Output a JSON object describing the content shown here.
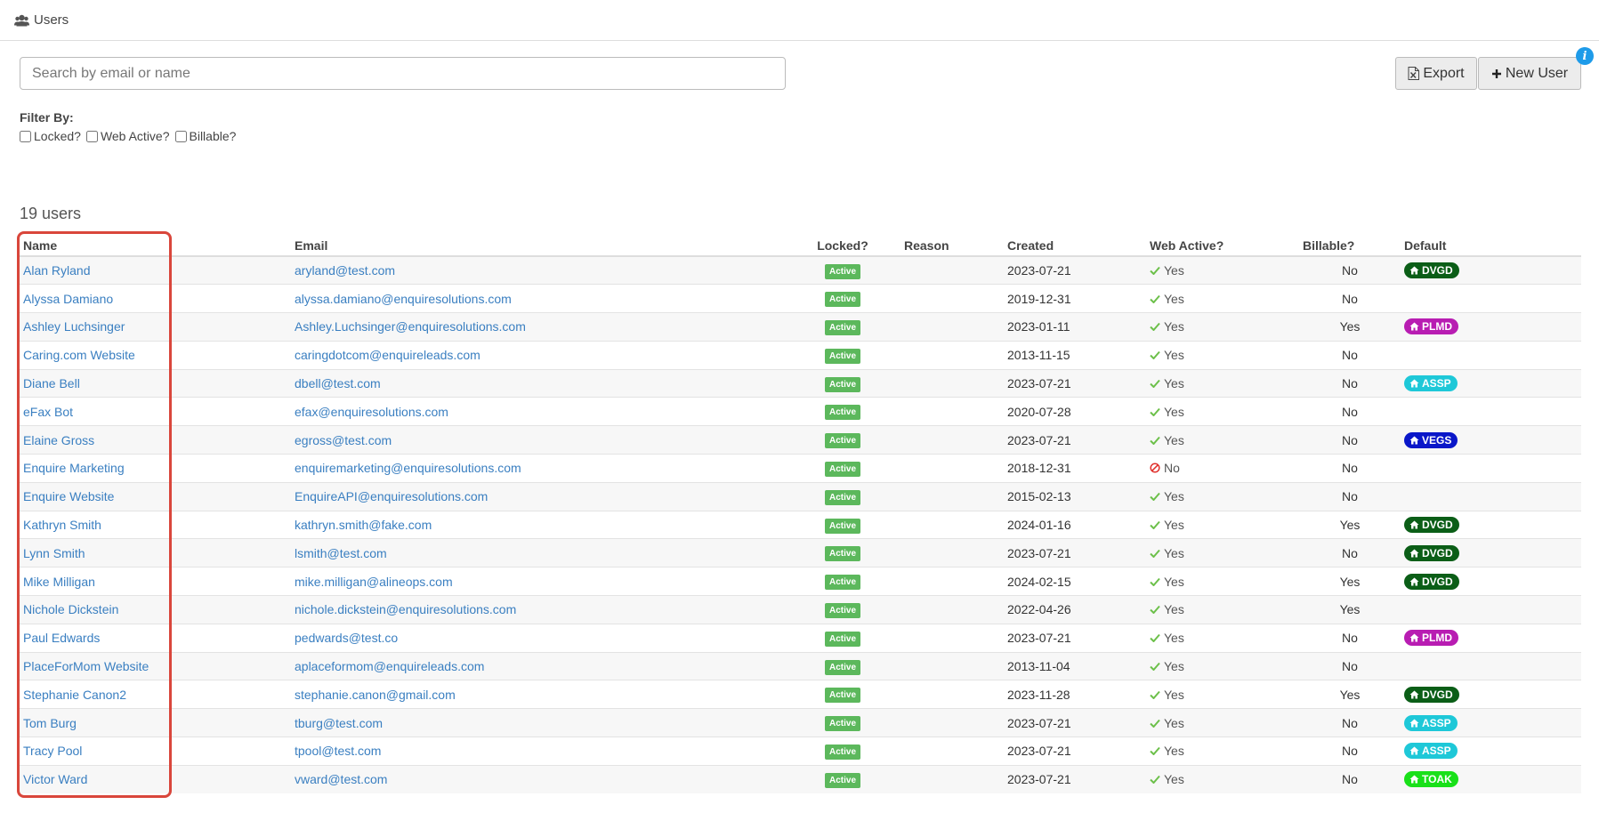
{
  "header": {
    "title": "Users",
    "icon": "users-icon"
  },
  "search": {
    "placeholder": "Search by email or name",
    "value": ""
  },
  "toolbar": {
    "export_label": "Export",
    "new_user_label": "New User",
    "info_label": "i"
  },
  "filters": {
    "title": "Filter By:",
    "options": [
      {
        "label": "Locked?",
        "checked": false
      },
      {
        "label": "Web Active?",
        "checked": false
      },
      {
        "label": "Billable?",
        "checked": false
      }
    ]
  },
  "summary": {
    "count_label": "19 users"
  },
  "table": {
    "columns": [
      "Name",
      "Email",
      "Locked?",
      "Reason",
      "Created",
      "Web Active?",
      "Billable?",
      "Default"
    ],
    "rows": [
      {
        "name": "Alan Ryland",
        "email": "aryland@test.com",
        "locked": "Active",
        "reason": "",
        "created": "2023-07-21",
        "web_active": "Yes",
        "billable": "No",
        "default": "DVGD",
        "default_color": "#0b5e17"
      },
      {
        "name": "Alyssa Damiano",
        "email": "alyssa.damiano@enquiresolutions.com",
        "locked": "Active",
        "reason": "",
        "created": "2019-12-31",
        "web_active": "Yes",
        "billable": "No",
        "default": "",
        "default_color": ""
      },
      {
        "name": "Ashley Luchsinger",
        "email": "Ashley.Luchsinger@enquiresolutions.com",
        "locked": "Active",
        "reason": "",
        "created": "2023-01-11",
        "web_active": "Yes",
        "billable": "Yes",
        "default": "PLMD",
        "default_color": "#b81db2"
      },
      {
        "name": "Caring.com Website",
        "email": "caringdotcom@enquireleads.com",
        "locked": "Active",
        "reason": "",
        "created": "2013-11-15",
        "web_active": "Yes",
        "billable": "No",
        "default": "",
        "default_color": ""
      },
      {
        "name": "Diane Bell",
        "email": "dbell@test.com",
        "locked": "Active",
        "reason": "",
        "created": "2023-07-21",
        "web_active": "Yes",
        "billable": "No",
        "default": "ASSP",
        "default_color": "#1ec8d8"
      },
      {
        "name": "eFax Bot",
        "email": "efax@enquiresolutions.com",
        "locked": "Active",
        "reason": "",
        "created": "2020-07-28",
        "web_active": "Yes",
        "billable": "No",
        "default": "",
        "default_color": ""
      },
      {
        "name": "Elaine Gross",
        "email": "egross@test.com",
        "locked": "Active",
        "reason": "",
        "created": "2023-07-21",
        "web_active": "Yes",
        "billable": "No",
        "default": "VEGS",
        "default_color": "#0a17c9"
      },
      {
        "name": "Enquire Marketing",
        "email": "enquiremarketing@enquiresolutions.com",
        "locked": "Active",
        "reason": "",
        "created": "2018-12-31",
        "web_active": "No",
        "billable": "No",
        "default": "",
        "default_color": ""
      },
      {
        "name": "Enquire Website",
        "email": "EnquireAPI@enquiresolutions.com",
        "locked": "Active",
        "reason": "",
        "created": "2015-02-13",
        "web_active": "Yes",
        "billable": "No",
        "default": "",
        "default_color": ""
      },
      {
        "name": "Kathryn Smith",
        "email": "kathryn.smith@fake.com",
        "locked": "Active",
        "reason": "",
        "created": "2024-01-16",
        "web_active": "Yes",
        "billable": "Yes",
        "default": "DVGD",
        "default_color": "#0b5e17"
      },
      {
        "name": "Lynn Smith",
        "email": "lsmith@test.com",
        "locked": "Active",
        "reason": "",
        "created": "2023-07-21",
        "web_active": "Yes",
        "billable": "No",
        "default": "DVGD",
        "default_color": "#0b5e17"
      },
      {
        "name": "Mike Milligan",
        "email": "mike.milligan@alineops.com",
        "locked": "Active",
        "reason": "",
        "created": "2024-02-15",
        "web_active": "Yes",
        "billable": "Yes",
        "default": "DVGD",
        "default_color": "#0b5e17"
      },
      {
        "name": "Nichole Dickstein",
        "email": "nichole.dickstein@enquiresolutions.com",
        "locked": "Active",
        "reason": "",
        "created": "2022-04-26",
        "web_active": "Yes",
        "billable": "Yes",
        "default": "",
        "default_color": ""
      },
      {
        "name": "Paul Edwards",
        "email": "pedwards@test.co",
        "locked": "Active",
        "reason": "",
        "created": "2023-07-21",
        "web_active": "Yes",
        "billable": "No",
        "default": "PLMD",
        "default_color": "#b81db2"
      },
      {
        "name": "PlaceForMom Website",
        "email": "aplaceformom@enquireleads.com",
        "locked": "Active",
        "reason": "",
        "created": "2013-11-04",
        "web_active": "Yes",
        "billable": "No",
        "default": "",
        "default_color": ""
      },
      {
        "name": "Stephanie Canon2",
        "email": "stephanie.canon@gmail.com",
        "locked": "Active",
        "reason": "",
        "created": "2023-11-28",
        "web_active": "Yes",
        "billable": "Yes",
        "default": "DVGD",
        "default_color": "#0b5e17"
      },
      {
        "name": "Tom Burg",
        "email": "tburg@test.com",
        "locked": "Active",
        "reason": "",
        "created": "2023-07-21",
        "web_active": "Yes",
        "billable": "No",
        "default": "ASSP",
        "default_color": "#1ec8d8"
      },
      {
        "name": "Tracy Pool",
        "email": "tpool@test.com",
        "locked": "Active",
        "reason": "",
        "created": "2023-07-21",
        "web_active": "Yes",
        "billable": "No",
        "default": "ASSP",
        "default_color": "#1ec8d8"
      },
      {
        "name": "Victor Ward",
        "email": "vward@test.com",
        "locked": "Active",
        "reason": "",
        "created": "2023-07-21",
        "web_active": "Yes",
        "billable": "No",
        "default": "TOAK",
        "default_color": "#19e019"
      }
    ]
  },
  "colors": {
    "link": "#3a7fc1",
    "active_badge": "#5cb85c",
    "check": "#6cc04a",
    "no_icon": "#e0302c",
    "info_badge": "#1e9be9",
    "highlight_border": "#d9463b"
  },
  "icons": {
    "export": "file-excel-icon",
    "new_user": "plus-icon",
    "web_yes": "check-icon",
    "web_no": "ban-icon",
    "default_tag": "home-icon"
  }
}
